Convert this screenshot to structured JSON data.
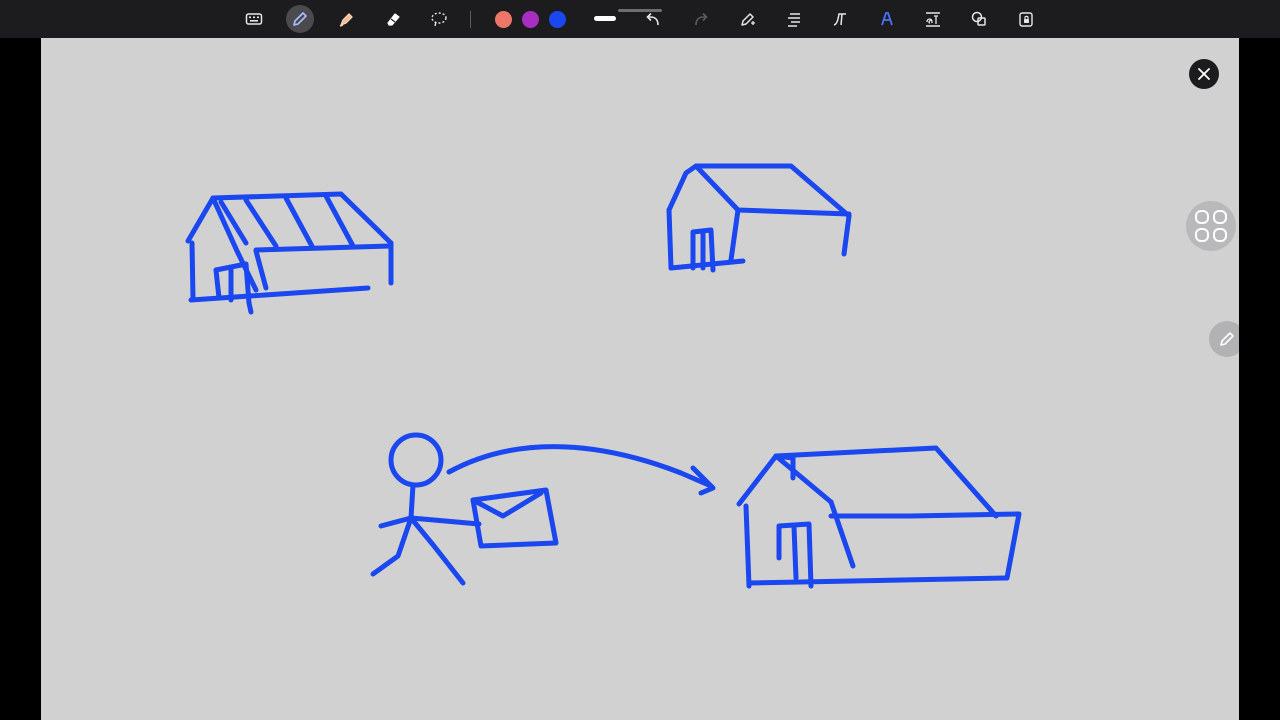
{
  "toolbar": {
    "tools": [
      {
        "name": "keyboard-icon",
        "active": false
      },
      {
        "name": "pen-icon",
        "active": true
      },
      {
        "name": "highlighter-icon",
        "active": false
      },
      {
        "name": "eraser-icon",
        "active": false
      },
      {
        "name": "lasso-icon",
        "active": false
      }
    ],
    "colors": [
      "#ee7668",
      "#a82ebf",
      "#1a47f0"
    ],
    "selected_color": "#1a47f0",
    "secondary_tools": [
      "undo-icon",
      "redo-icon",
      "pen-edit-icon",
      "text-align-icon",
      "text-style-icon",
      "handwriting-icon",
      "text-convert-icon",
      "shapes-icon",
      "lock-icon"
    ]
  },
  "canvas": {
    "background": "#d1d1d1",
    "ink_color": "#1a47f0",
    "drawings": [
      "house-top-left",
      "house-top-right",
      "stick-figure-with-envelope",
      "arrow-arc",
      "house-bottom-right"
    ]
  },
  "overlay_buttons": [
    "close-icon",
    "apps-grid-icon",
    "pencil-icon"
  ]
}
